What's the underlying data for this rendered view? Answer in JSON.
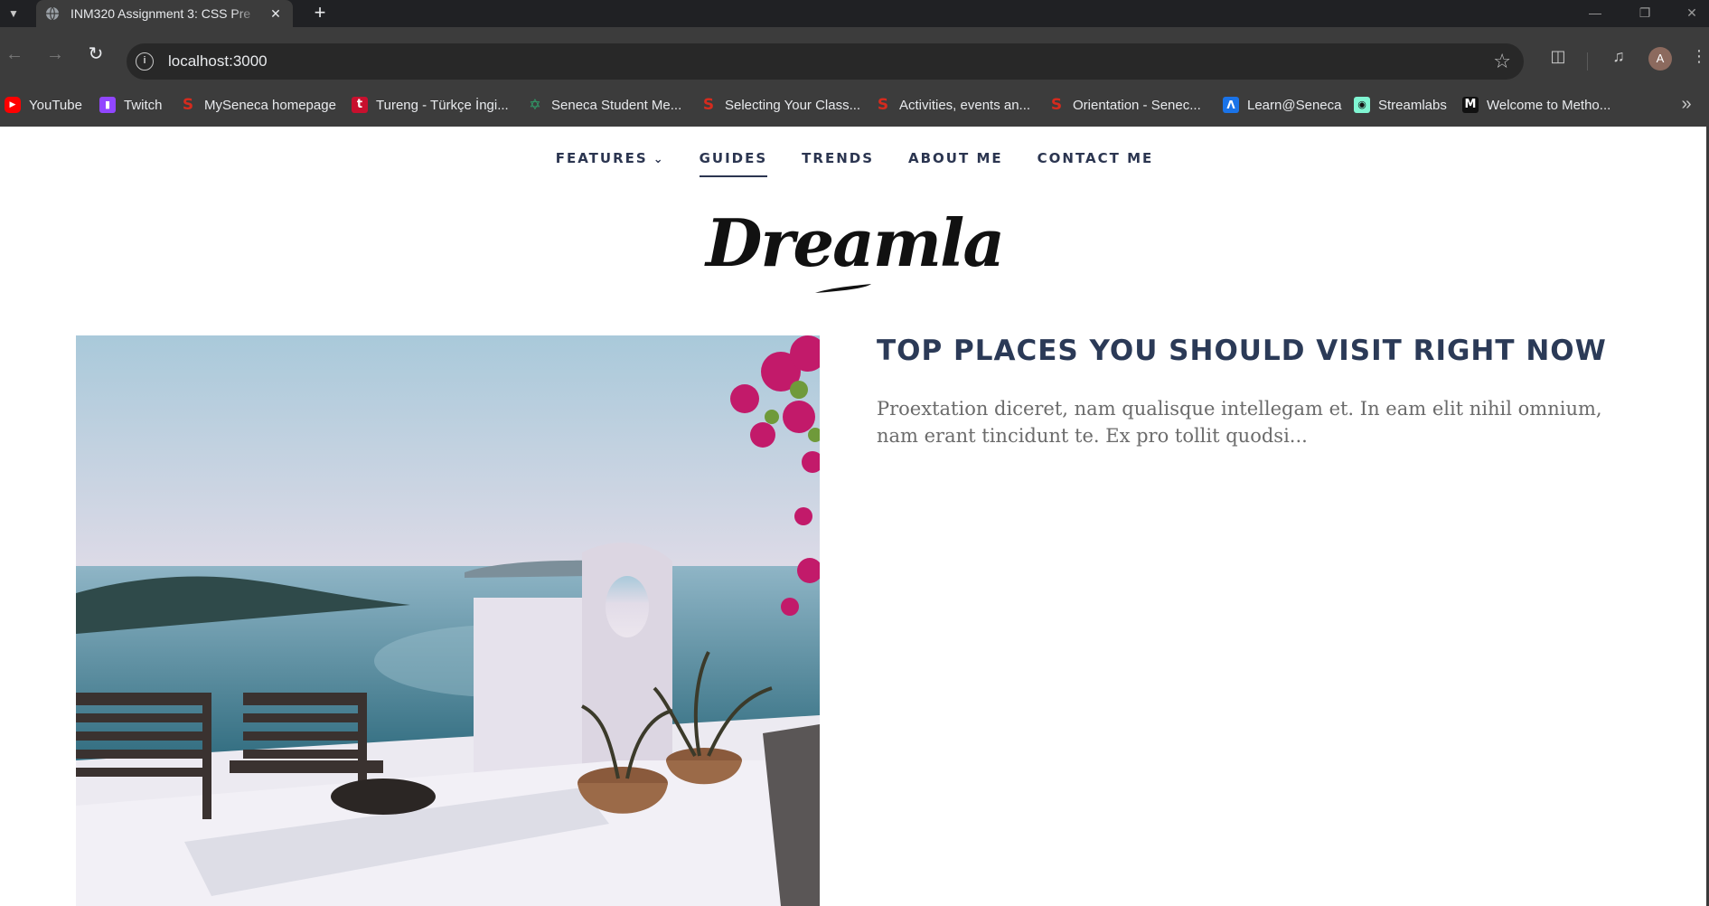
{
  "browser": {
    "tab_title": "INM320 Assignment 3: CSS Pre",
    "url": "localhost:3000",
    "avatar_letter": "A",
    "bookmarks": [
      {
        "label": "YouTube",
        "icon": "youtube-icon",
        "color": "#ff0000"
      },
      {
        "label": "Twitch",
        "icon": "twitch-icon",
        "color": "#9146ff"
      },
      {
        "label": "MySeneca homepage",
        "icon": "seneca-icon",
        "color": "#d52b1e"
      },
      {
        "label": "Tureng - Türkçe İngi...",
        "icon": "tureng-icon",
        "color": "#c8102e"
      },
      {
        "label": "Seneca Student Me...",
        "icon": "pinwheel-icon",
        "color": "#2fa36b"
      },
      {
        "label": "Selecting Your Class...",
        "icon": "seneca-icon",
        "color": "#d52b1e"
      },
      {
        "label": "Activities, events an...",
        "icon": "seneca-icon",
        "color": "#d52b1e"
      },
      {
        "label": "Orientation - Senec...",
        "icon": "seneca-icon",
        "color": "#d52b1e"
      },
      {
        "label": "Learn@Seneca",
        "icon": "learn-icon",
        "color": "#1a73e8"
      },
      {
        "label": "Streamlabs",
        "icon": "streamlabs-icon",
        "color": "#80f5d2"
      },
      {
        "label": "Welcome to Metho...",
        "icon": "metho-icon",
        "color": "#111111"
      }
    ]
  },
  "site": {
    "nav": [
      {
        "label": "FEATURES",
        "has_dropdown": true,
        "active": false
      },
      {
        "label": "GUIDES",
        "has_dropdown": false,
        "active": true
      },
      {
        "label": "TRENDS",
        "has_dropdown": false,
        "active": false
      },
      {
        "label": "ABOUT ME",
        "has_dropdown": false,
        "active": false
      },
      {
        "label": "CONTACT ME",
        "has_dropdown": false,
        "active": false
      }
    ],
    "logo": "Dreamla",
    "article": {
      "title": "TOP PLACES YOU SHOULD VISIT RIGHT NOW",
      "excerpt": "Proextation diceret, nam qualisque intellegam et. In eam elit nihil omnium, nam erant tincidunt te. Ex pro tollit quodsi..."
    }
  },
  "colors": {
    "nav_text": "#2b3550",
    "title_text": "#2b3a57",
    "excerpt_text": "#6b6b6b"
  }
}
